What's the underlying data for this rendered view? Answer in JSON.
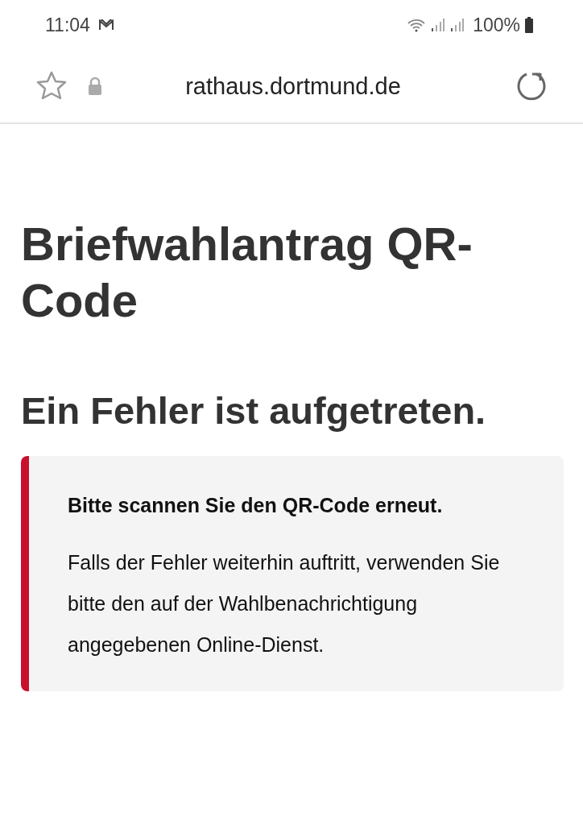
{
  "status_bar": {
    "time": "11:04",
    "battery": "100%"
  },
  "browser": {
    "url": "rathaus.dortmund.de"
  },
  "page": {
    "title": "Briefwahlantrag QR-Code",
    "error_heading": "Ein Fehler ist aufgetreten.",
    "alert": {
      "kind": "error",
      "color": "#c8102e",
      "headline": "Bitte scannen Sie den QR-Code erneut.",
      "body": "Falls der Fehler weiterhin auftritt, verwenden Sie bitte den auf der Wahlbenachrichtigung angegebenen Online-Dienst."
    }
  }
}
